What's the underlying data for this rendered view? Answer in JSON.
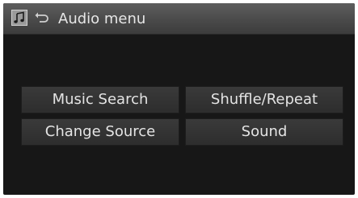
{
  "header": {
    "title": "Audio menu",
    "source_icon": "music-note-icon",
    "back_icon": "back-arrow-icon"
  },
  "menu": {
    "items": [
      {
        "label": "Music Search"
      },
      {
        "label": "Shuffle/Repeat"
      },
      {
        "label": "Change Source"
      },
      {
        "label": "Sound"
      }
    ]
  },
  "colors": {
    "screen_bg": "#171717",
    "titlebar_bg": "#4a4a4a",
    "button_bg": "#333333",
    "text": "#e4e4e4"
  }
}
